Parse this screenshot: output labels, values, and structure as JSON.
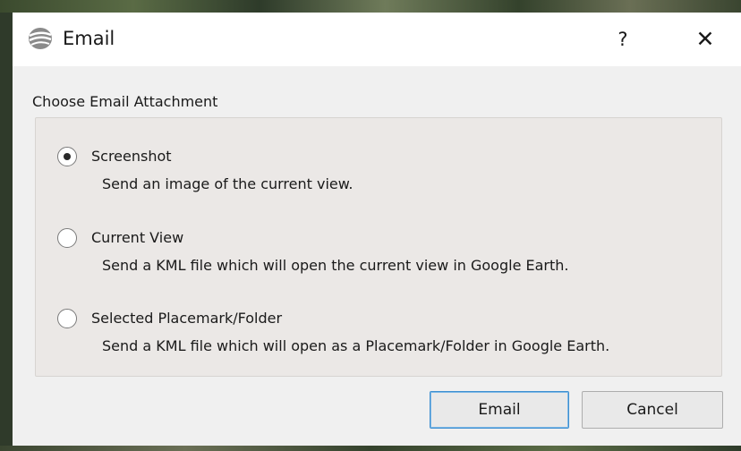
{
  "window": {
    "title": "Email",
    "help_label": "?",
    "close_label": "✕"
  },
  "dialog": {
    "section_title": "Choose Email Attachment",
    "selected_option": "Screenshot",
    "options": [
      {
        "label": "Screenshot",
        "description": "Send an image of the current view.",
        "checked": true
      },
      {
        "label": "Current View",
        "description": "Send a KML file which will open the current view in Google Earth.",
        "checked": false
      },
      {
        "label": "Selected Placemark/Folder",
        "description": "Send a KML file which will open as a Placemark/Folder in Google Earth.",
        "checked": false
      }
    ],
    "email_button": "Email",
    "cancel_button": "Cancel"
  },
  "icons": {
    "app": "google-earth-icon",
    "help": "question-mark-icon",
    "close": "close-icon"
  },
  "colors": {
    "default_button_border": "#3d8fd0",
    "group_box_bg": "#ebe8e6",
    "client_bg": "#f0f0f0"
  }
}
